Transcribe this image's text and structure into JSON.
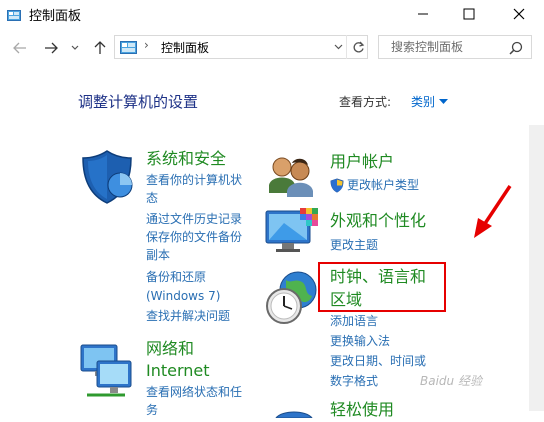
{
  "window": {
    "title": "控制面板"
  },
  "address": {
    "separator": "›",
    "path": "控制面板",
    "search_placeholder": "搜索控制面板"
  },
  "header": {
    "heading": "调整计算机的设置",
    "view_by_label": "查看方式:",
    "view_by_value": "类别"
  },
  "categories": [
    {
      "title": "系统和安全",
      "links": [
        "查看你的计算机状",
        "态",
        "通过文件历史记录",
        "保存你的文件备份",
        "副本",
        "备份和还原",
        "(Windows 7)",
        "查找并解决问题"
      ]
    },
    {
      "title": "网络和",
      "title2": "Internet",
      "links": [
        "查看网络状态和任",
        "务"
      ]
    },
    {
      "title": "用户帐户",
      "links": [
        "更改帐户类型"
      ]
    },
    {
      "title": "外观和个性化",
      "links": [
        "更改主题"
      ]
    },
    {
      "title": "时钟、语言和",
      "title2": "区域",
      "links": [
        "添加语言",
        "更换输入法",
        "更改日期、时间或",
        "数字格式"
      ]
    },
    {
      "title": "轻松使用"
    }
  ],
  "watermark": "Baidu 经验",
  "colors": {
    "heading": "#1e3287",
    "category_title": "#1f8a22",
    "link": "#2a6fb3",
    "highlight": "#e60000"
  }
}
